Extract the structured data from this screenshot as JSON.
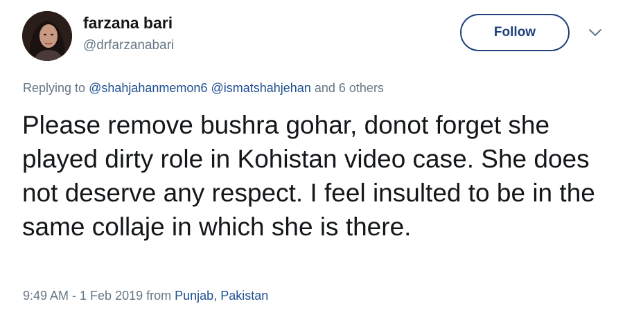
{
  "author": {
    "name": "farzana bari",
    "handle": "@drfarzanabari"
  },
  "actions": {
    "follow_label": "Follow",
    "menu_icon": "chevron-down-icon"
  },
  "reply": {
    "prefix": "Replying to",
    "mention1": "@shahjahanmemon6",
    "mention2": "@ismatshahjehan",
    "others": "and 6 others"
  },
  "tweet": {
    "text": "Please remove bushra gohar, donot forget she played dirty role in Kohistan video case. She does not deserve any respect. I feel insulted to be in the same collaje in which she is there."
  },
  "meta": {
    "timestamp": "9:49 AM - 1 Feb 2019",
    "from_label": "from",
    "location": "Punjab, Pakistan"
  },
  "colors": {
    "accent": "#1d3f7a",
    "link": "#1d4f91",
    "muted": "#657786",
    "text": "#14171a"
  }
}
